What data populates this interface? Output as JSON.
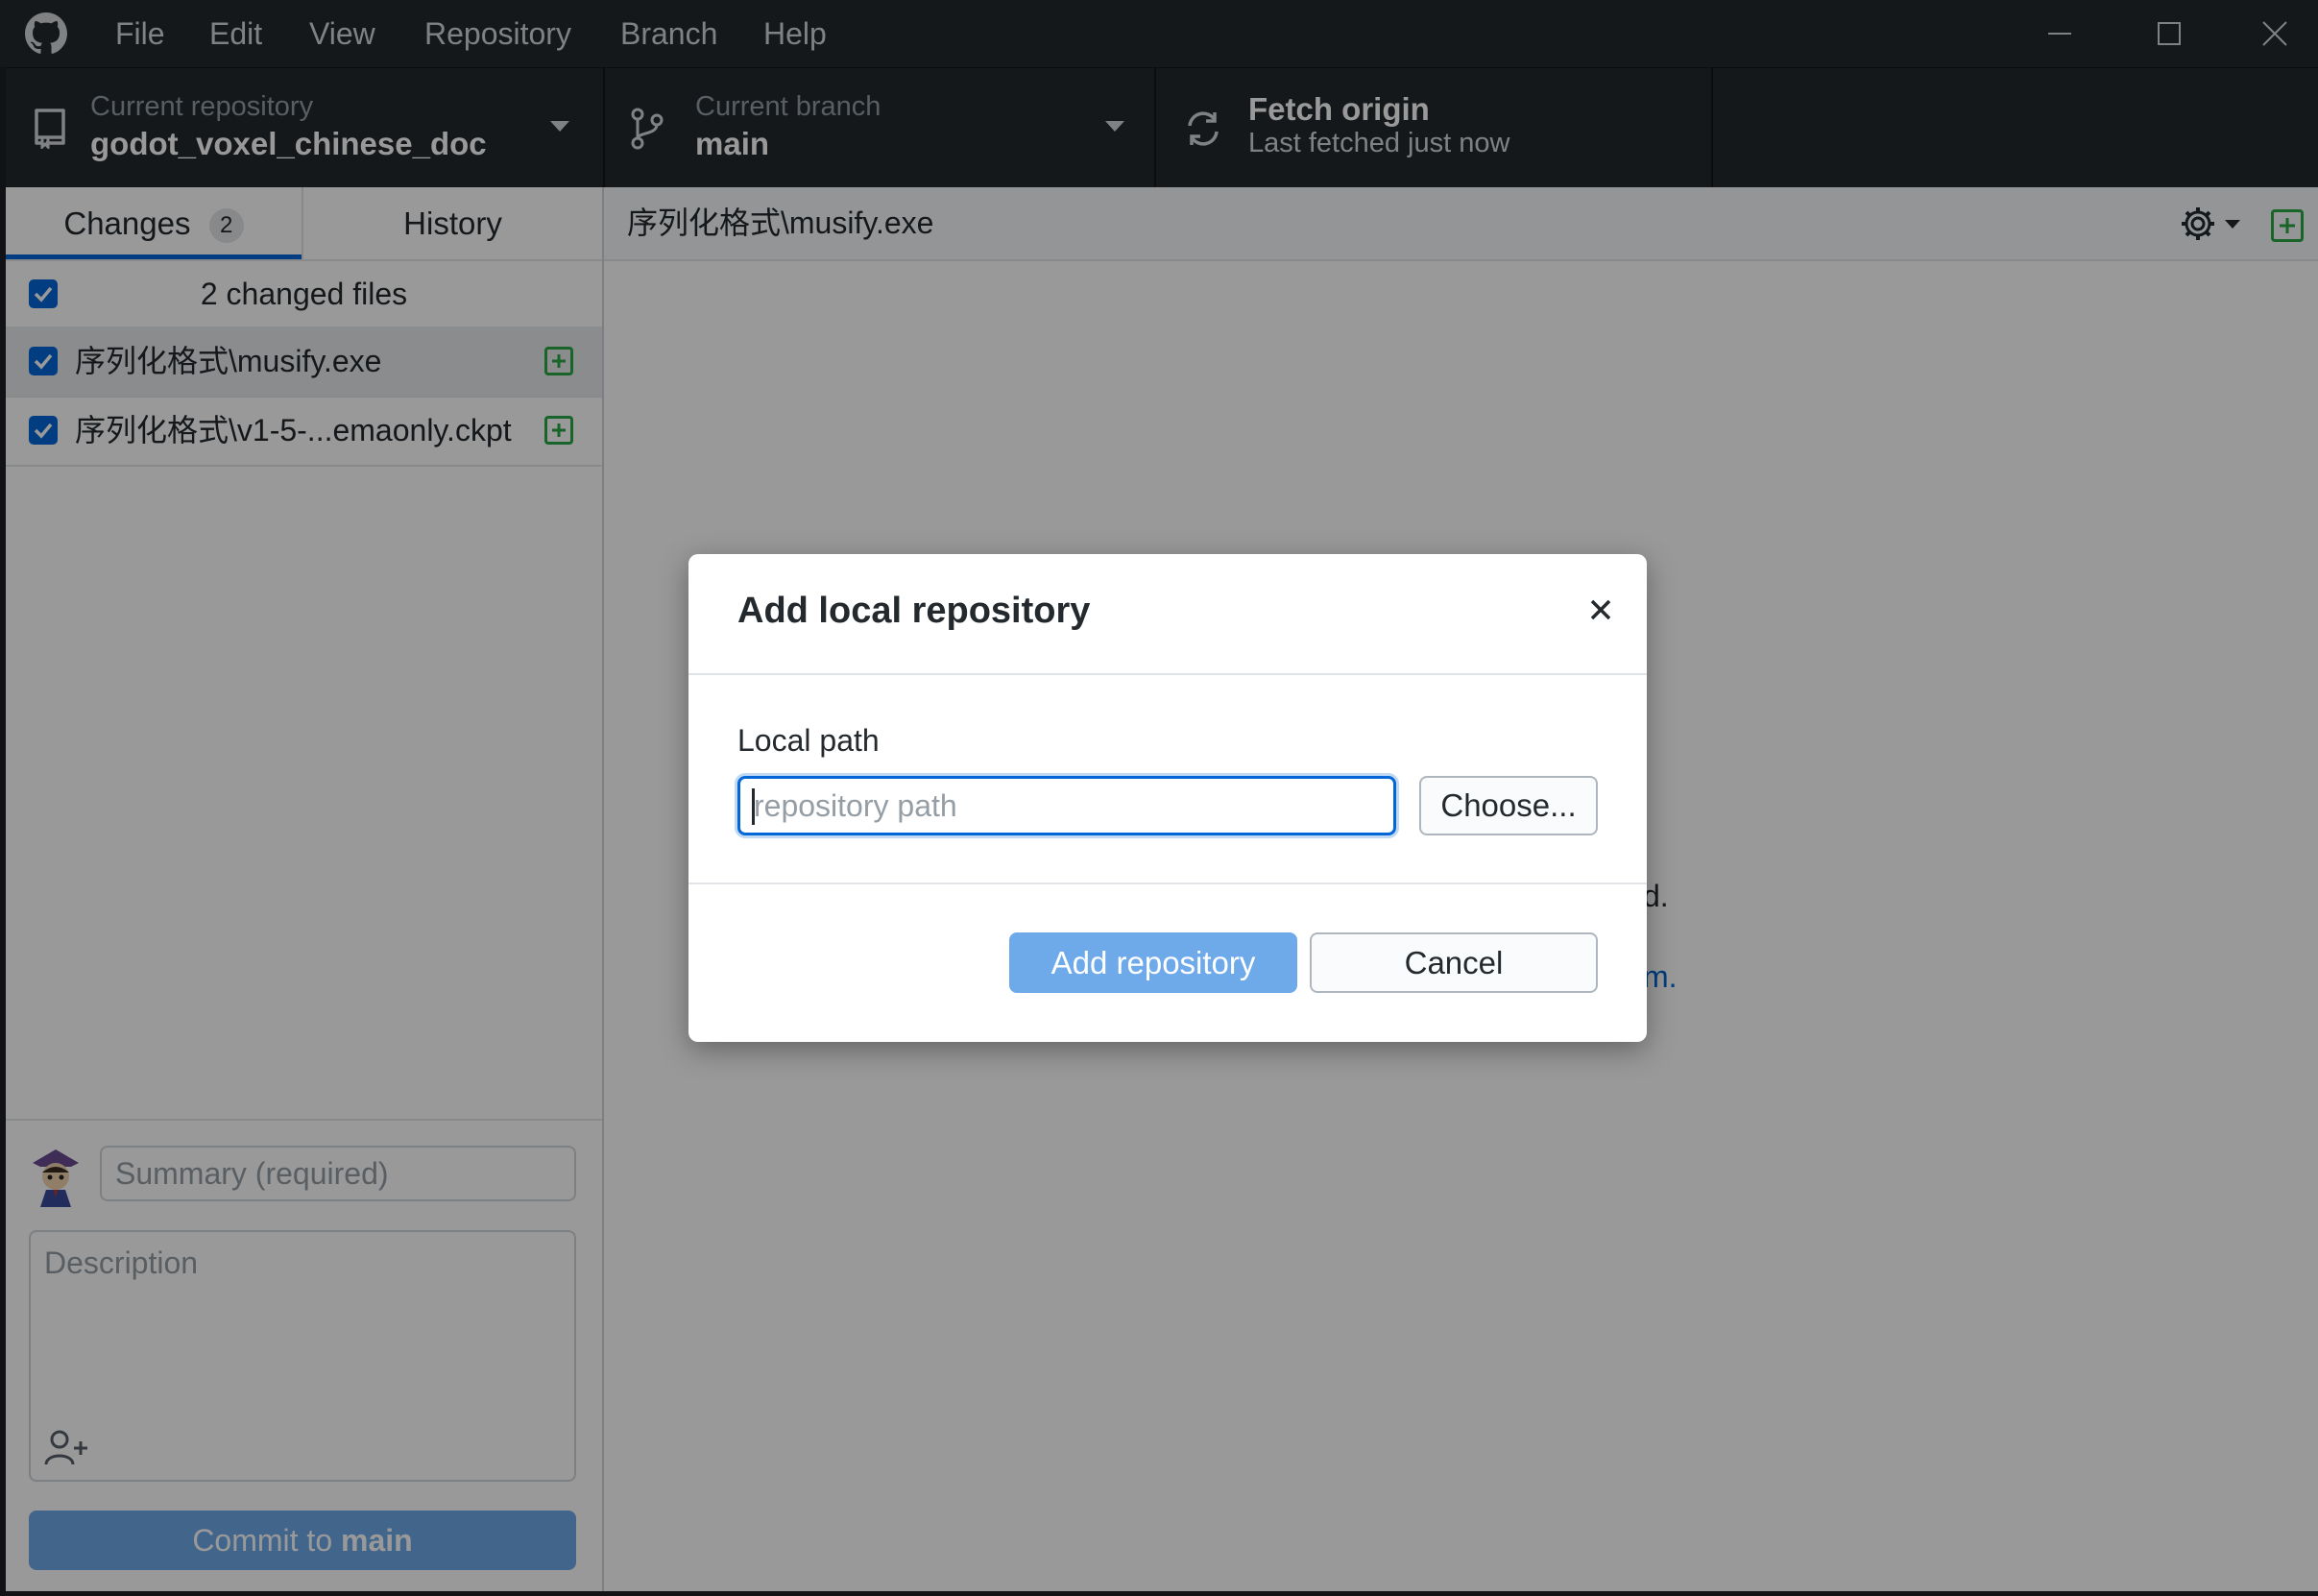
{
  "menu": {
    "items": [
      "File",
      "Edit",
      "View",
      "Repository",
      "Branch",
      "Help"
    ]
  },
  "toolbar": {
    "repository": {
      "label": "Current repository",
      "value": "godot_voxel_chinese_doc"
    },
    "branch": {
      "label": "Current branch",
      "value": "main"
    },
    "fetch": {
      "title": "Fetch origin",
      "subtitle": "Last fetched just now"
    }
  },
  "sidebar": {
    "tabs": {
      "changes": "Changes",
      "changes_count": "2",
      "history": "History"
    },
    "changed_files_label": "2 changed files",
    "files": [
      {
        "name": "序列化格式\\musify.exe"
      },
      {
        "name": "序列化格式\\v1-5-...emaonly.ckpt"
      }
    ],
    "summary_placeholder": "Summary (required)",
    "description_placeholder": "Description",
    "commit_prefix": "Commit to ",
    "commit_branch": "main"
  },
  "diff": {
    "file_path": "序列化格式\\musify.exe",
    "obscured_text_1": "d.",
    "obscured_text_2": "m."
  },
  "modal": {
    "title": "Add local repository",
    "field_label": "Local path",
    "input_placeholder": "repository path",
    "input_value": "",
    "choose_label": "Choose...",
    "add_label": "Add repository",
    "cancel_label": "Cancel"
  },
  "colors": {
    "accent": "#0366d6",
    "titlebar": "#24292e",
    "added": "#28a745",
    "primary_button_disabled": "#6ea9ea"
  }
}
